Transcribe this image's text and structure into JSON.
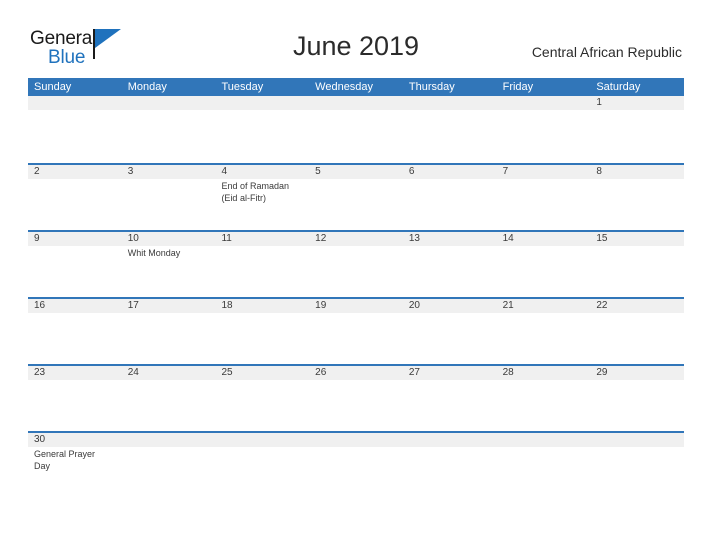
{
  "header": {
    "logo": {
      "text_top": "General",
      "text_bottom": "Blue",
      "flag_icon": "blue-flag-triangle",
      "color_dark": "#1a1a1a",
      "color_blue": "#1f72bd"
    },
    "month_title": "June 2019",
    "country": "Central African Republic"
  },
  "calendar": {
    "header_color": "#3176b9",
    "numband_color": "#f0f0f0",
    "text_color": "#3a3a3a",
    "weekdays": [
      "Sunday",
      "Monday",
      "Tuesday",
      "Wednesday",
      "Thursday",
      "Friday",
      "Saturday"
    ],
    "weeks": [
      {
        "days": [
          {
            "num": "",
            "events": []
          },
          {
            "num": "",
            "events": []
          },
          {
            "num": "",
            "events": []
          },
          {
            "num": "",
            "events": []
          },
          {
            "num": "",
            "events": []
          },
          {
            "num": "",
            "events": []
          },
          {
            "num": "1",
            "events": []
          }
        ]
      },
      {
        "days": [
          {
            "num": "2",
            "events": []
          },
          {
            "num": "3",
            "events": []
          },
          {
            "num": "4",
            "events": [
              "End of Ramadan",
              "(Eid al-Fitr)"
            ]
          },
          {
            "num": "5",
            "events": []
          },
          {
            "num": "6",
            "events": []
          },
          {
            "num": "7",
            "events": []
          },
          {
            "num": "8",
            "events": []
          }
        ]
      },
      {
        "days": [
          {
            "num": "9",
            "events": []
          },
          {
            "num": "10",
            "events": [
              "Whit Monday"
            ]
          },
          {
            "num": "11",
            "events": []
          },
          {
            "num": "12",
            "events": []
          },
          {
            "num": "13",
            "events": []
          },
          {
            "num": "14",
            "events": []
          },
          {
            "num": "15",
            "events": []
          }
        ]
      },
      {
        "days": [
          {
            "num": "16",
            "events": []
          },
          {
            "num": "17",
            "events": []
          },
          {
            "num": "18",
            "events": []
          },
          {
            "num": "19",
            "events": []
          },
          {
            "num": "20",
            "events": []
          },
          {
            "num": "21",
            "events": []
          },
          {
            "num": "22",
            "events": []
          }
        ]
      },
      {
        "days": [
          {
            "num": "23",
            "events": []
          },
          {
            "num": "24",
            "events": []
          },
          {
            "num": "25",
            "events": []
          },
          {
            "num": "26",
            "events": []
          },
          {
            "num": "27",
            "events": []
          },
          {
            "num": "28",
            "events": []
          },
          {
            "num": "29",
            "events": []
          }
        ]
      },
      {
        "days": [
          {
            "num": "30",
            "events": [
              "General Prayer",
              "Day"
            ]
          },
          {
            "num": "",
            "events": []
          },
          {
            "num": "",
            "events": []
          },
          {
            "num": "",
            "events": []
          },
          {
            "num": "",
            "events": []
          },
          {
            "num": "",
            "events": []
          },
          {
            "num": "",
            "events": []
          }
        ]
      }
    ]
  }
}
